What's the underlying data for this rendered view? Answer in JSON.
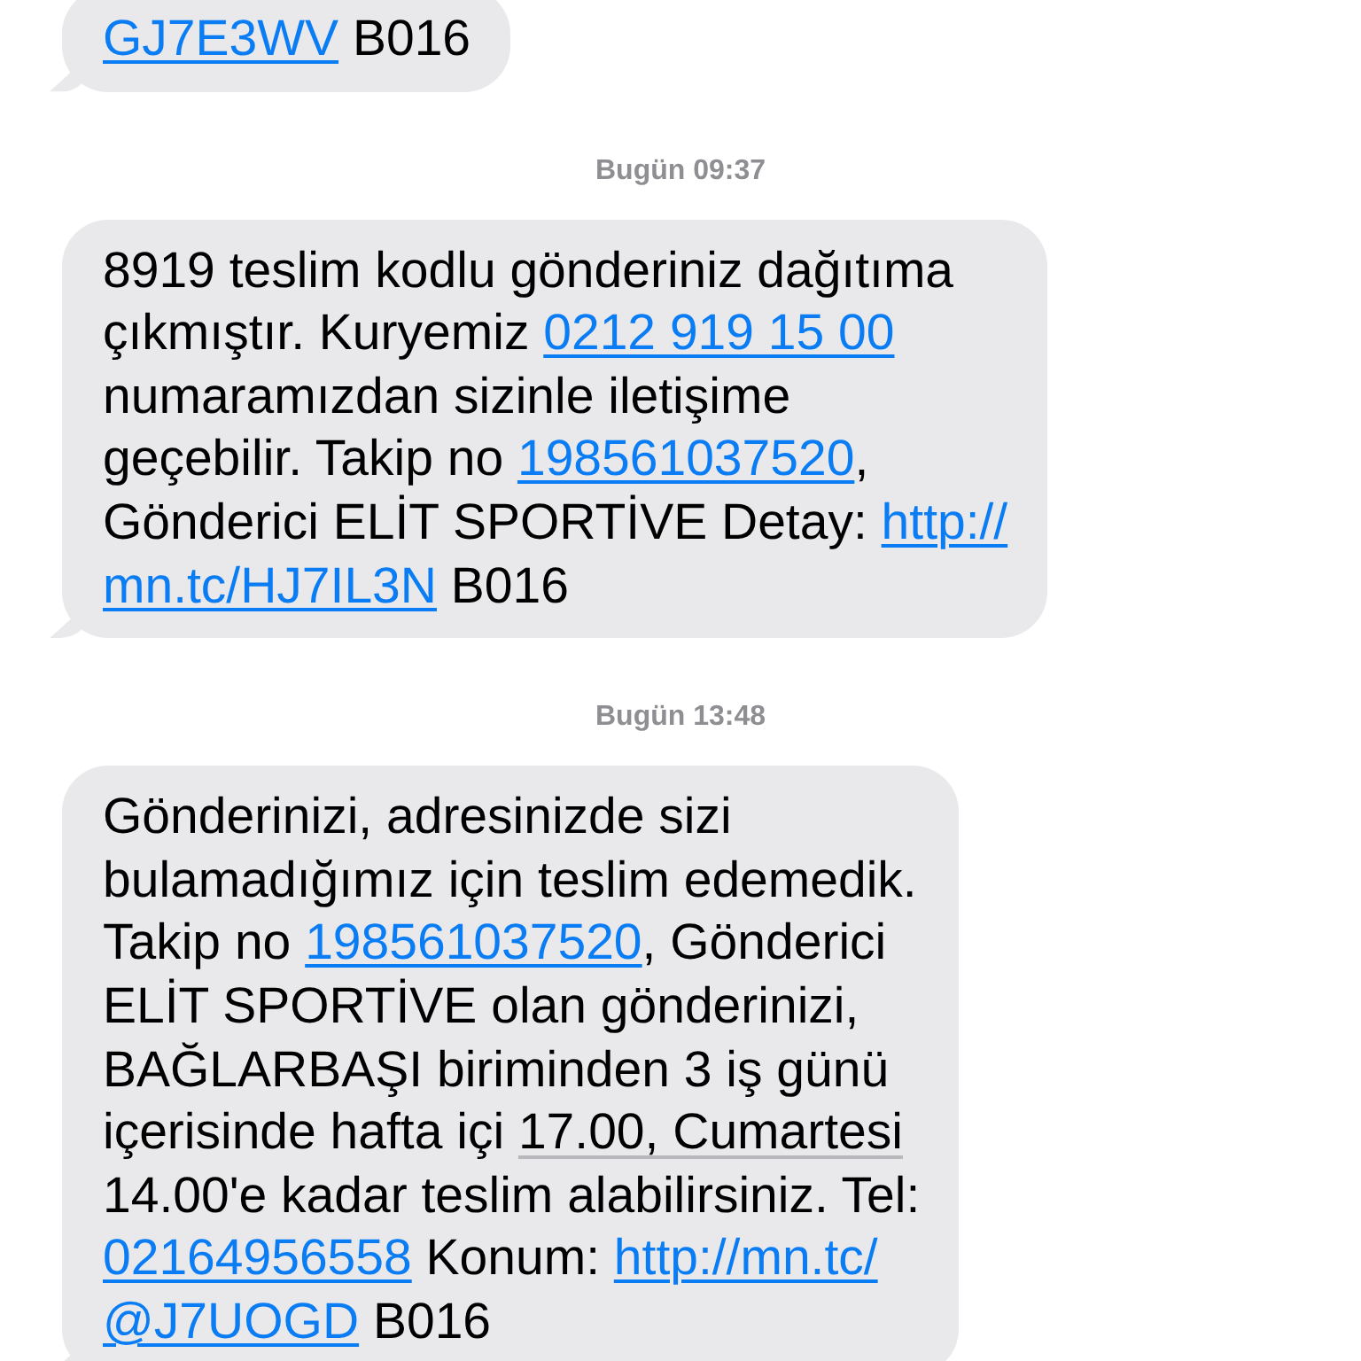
{
  "messages": [
    {
      "kind": "bubble",
      "lines": [
        [
          {
            "text": "GJ7E3WV",
            "kind": "link"
          },
          {
            "text": " B016",
            "kind": "plain"
          }
        ]
      ]
    },
    {
      "kind": "timestamp",
      "text": "Bugün 09:37"
    },
    {
      "kind": "bubble",
      "lines": [
        [
          {
            "text": "8919 teslim kodlu gönderiniz dağıtıma",
            "kind": "plain"
          }
        ],
        [
          {
            "text": "çıkmıştır. Kuryemiz ",
            "kind": "plain"
          },
          {
            "text": "0212 919 15 00",
            "kind": "phone"
          }
        ],
        [
          {
            "text": "numaramızdan sizinle iletişime",
            "kind": "plain"
          }
        ],
        [
          {
            "text": "geçebilir. Takip no ",
            "kind": "plain"
          },
          {
            "text": "198561037520",
            "kind": "number"
          },
          {
            "text": ",",
            "kind": "plain"
          }
        ],
        [
          {
            "text": "Gönderici ELİT SPORTİVE Detay: ",
            "kind": "plain"
          },
          {
            "text": "http://",
            "kind": "link"
          }
        ],
        [
          {
            "text": "mn.tc/HJ7IL3N",
            "kind": "link"
          },
          {
            "text": " B016",
            "kind": "plain"
          }
        ]
      ]
    },
    {
      "kind": "timestamp",
      "text": "Bugün 13:48"
    },
    {
      "kind": "bubble",
      "lines": [
        [
          {
            "text": "Gönderinizi, adresinizde sizi",
            "kind": "plain"
          }
        ],
        [
          {
            "text": "bulamadığımız için teslim edemedik.",
            "kind": "plain"
          }
        ],
        [
          {
            "text": "Takip no ",
            "kind": "plain"
          },
          {
            "text": "198561037520",
            "kind": "number"
          },
          {
            "text": ", Gönderici",
            "kind": "plain"
          }
        ],
        [
          {
            "text": "ELİT SPORTİVE olan gönderinizi,",
            "kind": "plain"
          }
        ],
        [
          {
            "text": "BAĞLARBAŞI biriminden 3 iş günü",
            "kind": "plain"
          }
        ],
        [
          {
            "text": "içerisinde hafta içi ",
            "kind": "plain"
          },
          {
            "text": "17.00, Cumartesi",
            "kind": "date"
          }
        ],
        [
          {
            "text": "14.00'e kadar teslim alabilirsiniz. Tel:",
            "kind": "plain"
          }
        ],
        [
          {
            "text": "02164956558",
            "kind": "phone"
          },
          {
            "text": " Konum: ",
            "kind": "plain"
          },
          {
            "text": "http://mn.tc/",
            "kind": "link"
          }
        ],
        [
          {
            "text": "@J7UOGD",
            "kind": "link"
          },
          {
            "text": " B016",
            "kind": "plain"
          }
        ]
      ]
    }
  ]
}
